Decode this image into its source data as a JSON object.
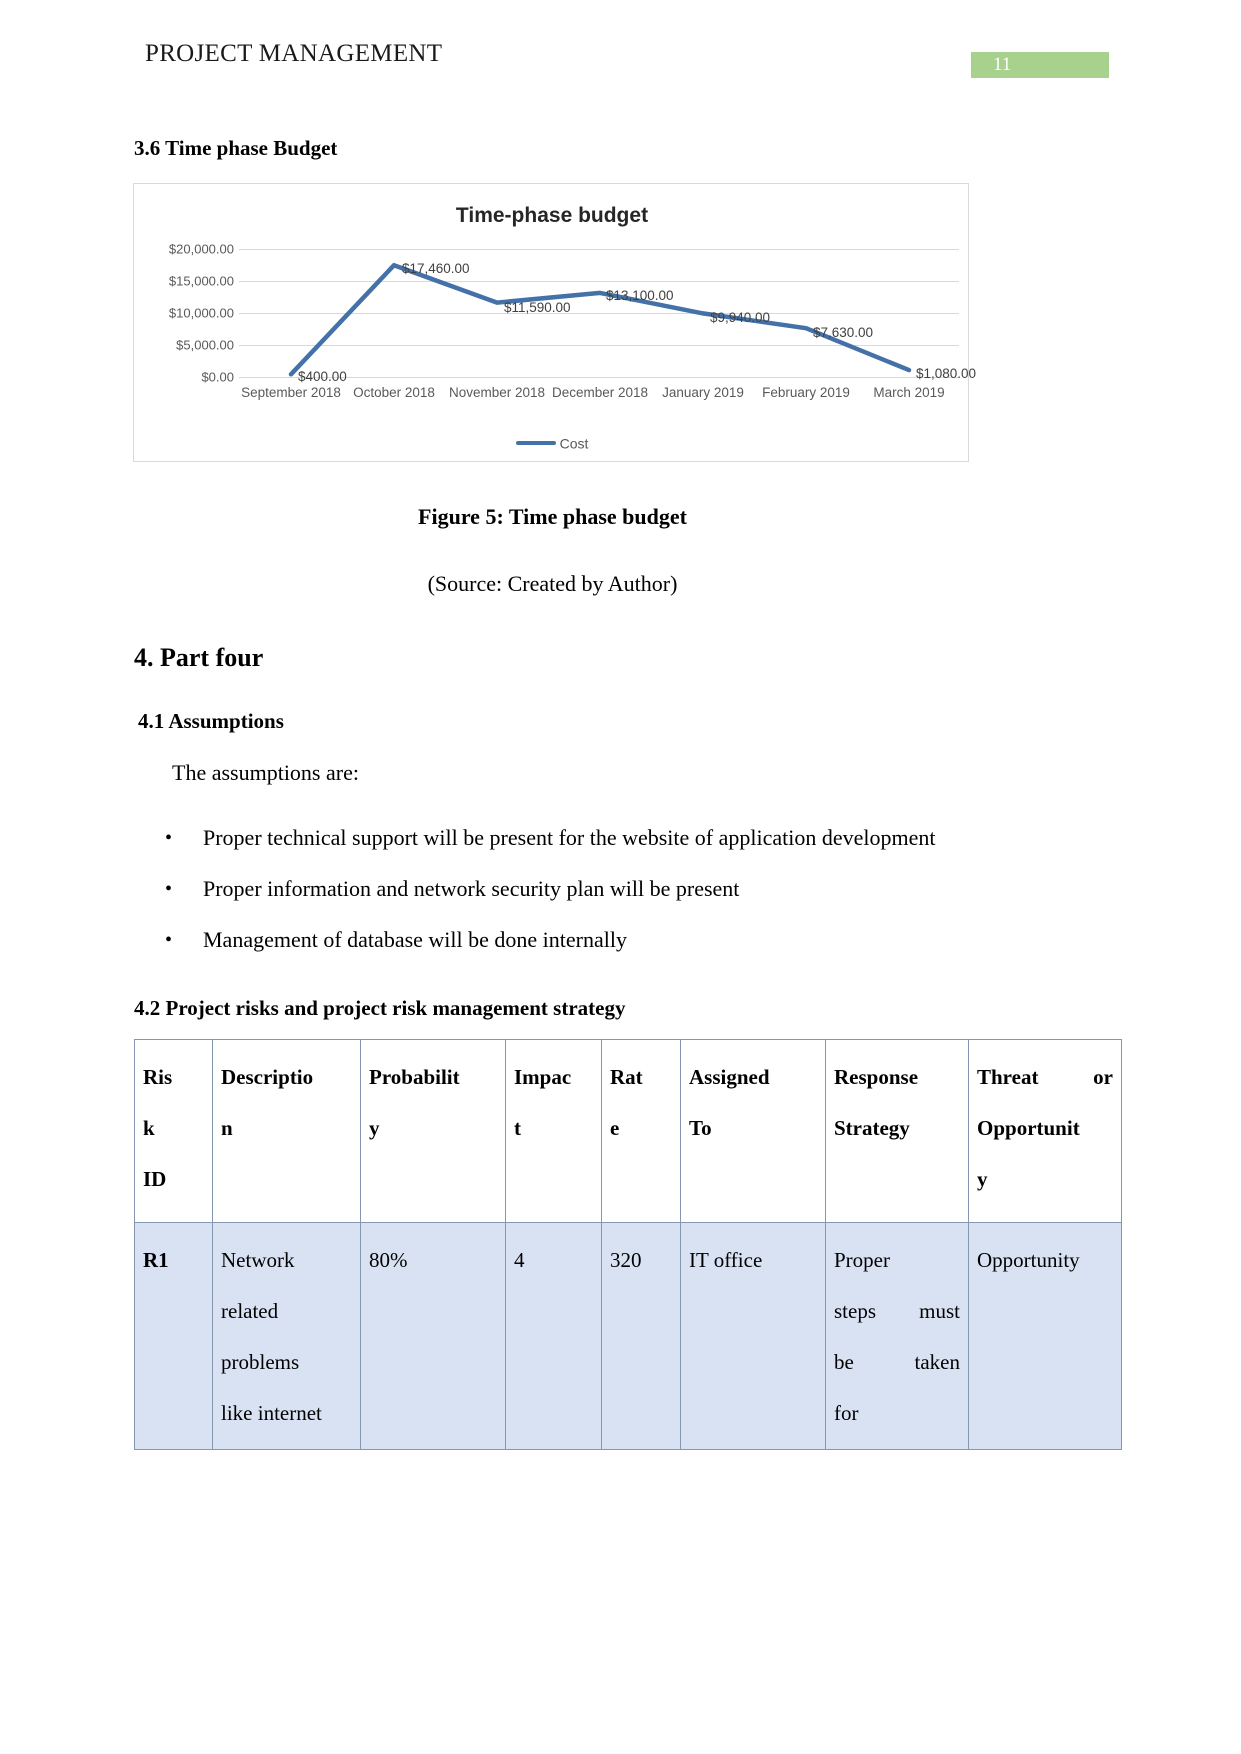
{
  "header": {
    "document_title": "PROJECT MANAGEMENT",
    "page_number": "11",
    "badge_color": "#a9d18e"
  },
  "sections": {
    "sec_3_6": "3.6 Time phase Budget",
    "part_four": "4. Part four",
    "sec_4_1": "4.1 Assumptions",
    "sec_4_2": "4.2 Project risks and project risk management strategy"
  },
  "figure": {
    "caption": "Figure 5: Time phase budget",
    "source": "(Source: Created by Author)"
  },
  "assumptions": {
    "intro": "The assumptions are:",
    "items": [
      "Proper technical support will be present for the website of application development",
      "Proper information and network security plan will be present",
      "Management of database will be done internally"
    ]
  },
  "chart_data": {
    "type": "line",
    "title": "Time-phase budget",
    "xlabel": "",
    "ylabel": "",
    "categories": [
      "September 2018",
      "October 2018",
      "November 2018",
      "December 2018",
      "January 2019",
      "February 2019",
      "March 2019"
    ],
    "series": [
      {
        "name": "Cost",
        "color": "#4472a8",
        "values": [
          400,
          17460,
          11590,
          13100,
          9940,
          7630,
          1080
        ],
        "data_labels": [
          "$400.00",
          "$17,460.00",
          "$11,590.00",
          "$13,100.00",
          "$9,940.00",
          "$7,630.00",
          "$1,080.00"
        ]
      }
    ],
    "ytick_labels": [
      "$20,000.00",
      "$15,000.00",
      "$10,000.00",
      "$5,000.00",
      "$0.00"
    ],
    "ytick_values": [
      20000,
      15000,
      10000,
      5000,
      0
    ],
    "ylim": [
      0,
      20000
    ],
    "grid": true,
    "legend": {
      "position": "bottom",
      "entries": [
        "Cost"
      ]
    }
  },
  "risk_table": {
    "headers": [
      "Ris k ID",
      "Descriptio n",
      "Probabilit y",
      "Impac t",
      "Rat e",
      "Assigned To",
      "Response Strategy",
      "Threat or Opportunit y"
    ],
    "header_lines": [
      [
        "Ris",
        "k",
        "ID"
      ],
      [
        "Descriptio",
        "n",
        ""
      ],
      [
        "Probabilit",
        "y",
        ""
      ],
      [
        "Impac",
        "t",
        ""
      ],
      [
        "Rat",
        "e",
        ""
      ],
      [
        "Assigned",
        "To",
        ""
      ],
      [
        "Response",
        "Strategy",
        ""
      ],
      [
        "Threat     or",
        "Opportunit",
        "y"
      ]
    ],
    "rows": [
      {
        "risk_id": "R1",
        "description_lines": [
          "Network",
          "related",
          "problems",
          "like internet"
        ],
        "probability": "80%",
        "impact": "4",
        "rate": "320",
        "assigned_to": "IT office",
        "response_lines": [
          "Proper",
          "steps    must",
          "be        taken",
          "for"
        ],
        "threat_or_opportunity": "Opportunity"
      }
    ]
  }
}
